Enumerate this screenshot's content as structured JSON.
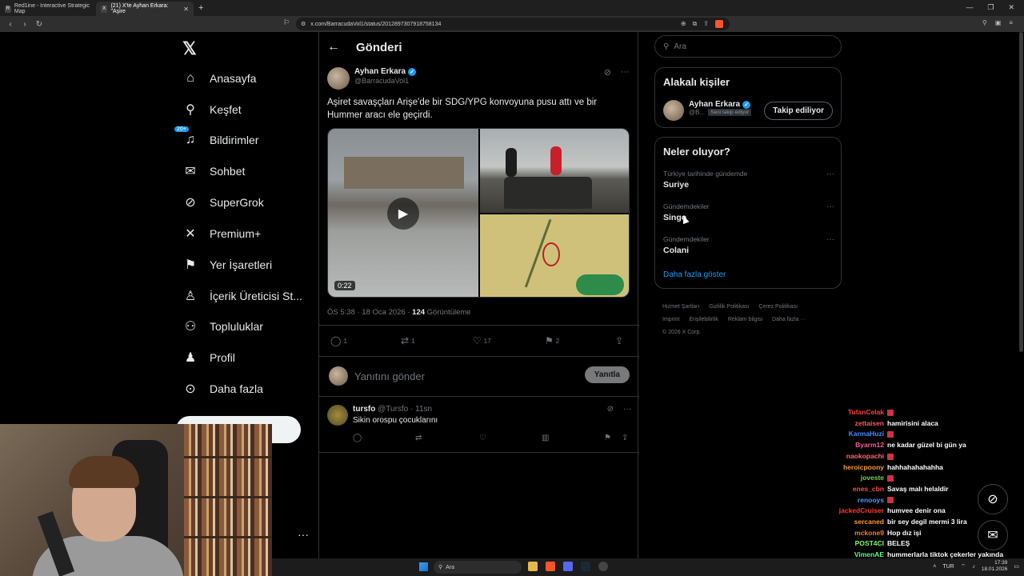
{
  "browser": {
    "tabs": [
      {
        "label": "Red1ine - Interactive Strategic Map",
        "active": false
      },
      {
        "label": "(21) X'te Ayhan Erkara: \"Aşire",
        "active": true
      }
    ],
    "url": "x.com/BarracudaVol1/status/2012897307918758134"
  },
  "nav": {
    "items": [
      {
        "label": "Anasayfa",
        "icon": "home-icon"
      },
      {
        "label": "Keşfet",
        "icon": "search-icon"
      },
      {
        "label": "Bildirimler",
        "icon": "bell-icon",
        "badge": "20+"
      },
      {
        "label": "Sohbet",
        "icon": "mail-icon"
      },
      {
        "label": "SuperGrok",
        "icon": "grok-icon"
      },
      {
        "label": "Premium+",
        "icon": "x-icon"
      },
      {
        "label": "Yer İşaretleri",
        "icon": "bookmark-icon"
      },
      {
        "label": "İçerik Üreticisi St...",
        "icon": "creator-icon"
      },
      {
        "label": "Topluluklar",
        "icon": "communities-icon"
      },
      {
        "label": "Profil",
        "icon": "profile-icon"
      },
      {
        "label": "Daha fazla",
        "icon": "more-icon"
      }
    ]
  },
  "post": {
    "header_title": "Gönderi",
    "author_name": "Ayhan Erkara",
    "author_handle": "@BarracudaVol1",
    "text": "Aşiret savaşçları Arişe'de bir SDG/YPG konvoyuna pusu attı ve bir Hummer aracı ele geçirdi.",
    "video_duration": "0:22",
    "time": "ÖS 5:38 · 18 Oca 2026 · ",
    "views_count": "124",
    "views_label": " Görüntüleme",
    "replies": "1",
    "reposts": "1",
    "likes": "17",
    "bookmarks": "2"
  },
  "reply_box": {
    "placeholder": "Yanıtını gönder",
    "button": "Yanıtla"
  },
  "comment": {
    "name": "tursfo",
    "meta": " @Tursfo · 11sn",
    "text": "Sikin orospu çocuklarını"
  },
  "sidebar": {
    "search_placeholder": "Ara",
    "related_title": "Alakalı kişiler",
    "related_person": {
      "name": "Ayhan Erkara",
      "handle": "@B...",
      "follows_you": "Seni takip ediyor",
      "follow_button": "Takip ediliyor"
    },
    "trends_title": "Neler oluyor?",
    "trends": [
      {
        "category": "Türkiye tarihinde gündemde",
        "title": "Suriye"
      },
      {
        "category": "Gündemdekiler",
        "title": "Singo"
      },
      {
        "category": "Gündemdekiler",
        "title": "Colani"
      }
    ],
    "show_more": "Daha fazla göster",
    "footer": [
      "Hizmet Şartları",
      "Gizlilik Politikası",
      "Çerez Politikası",
      "Imprint",
      "Erişilebilirlik",
      "Reklam bilgisi",
      "Daha fazla ···",
      "© 2026 X Corp."
    ]
  },
  "chat": [
    {
      "user": "TufanCelak",
      "color": "#ff4040",
      "msg": ""
    },
    {
      "user": "zettaisen",
      "color": "#ff5a5a",
      "msg": "hamirisini alaca"
    },
    {
      "user": "KarmaHuzi",
      "color": "#4a8cff",
      "msg": ""
    },
    {
      "user": "Byarm12",
      "color": "#ff5a9a",
      "msg": "ne kadar güzel bi gün ya"
    },
    {
      "user": "naokopachi",
      "color": "#ff6a6a",
      "msg": ""
    },
    {
      "user": "heroicpoony",
      "color": "#ff9a3a",
      "msg": "hahhahahahahha"
    },
    {
      "user": "joveste",
      "color": "#7ad04a",
      "msg": ""
    },
    {
      "user": "enes_cbn",
      "color": "#ff4a4a",
      "msg": "Savaş malı helaldir"
    },
    {
      "user": "renooys",
      "color": "#4a9aff",
      "msg": ""
    },
    {
      "user": "jackedCruiser",
      "color": "#ff3a3a",
      "msg": "humvee denir ona"
    },
    {
      "user": "sercaned",
      "color": "#ff9a2a",
      "msg": "bir sey degil mermi 3 lira"
    },
    {
      "user": "mckone9",
      "color": "#ff7a3a",
      "msg": "Hop dız işi"
    },
    {
      "user": "POST4CI",
      "color": "#7aff5a",
      "msg": "BELEŞ"
    },
    {
      "user": "VimenAE",
      "color": "#5aff9a",
      "msg": "hummerlarla tiktok çekerler yakında"
    }
  ],
  "taskbar": {
    "search": "Ara",
    "lang": "TUR",
    "time": "17:39",
    "date": "18.01.2026"
  }
}
